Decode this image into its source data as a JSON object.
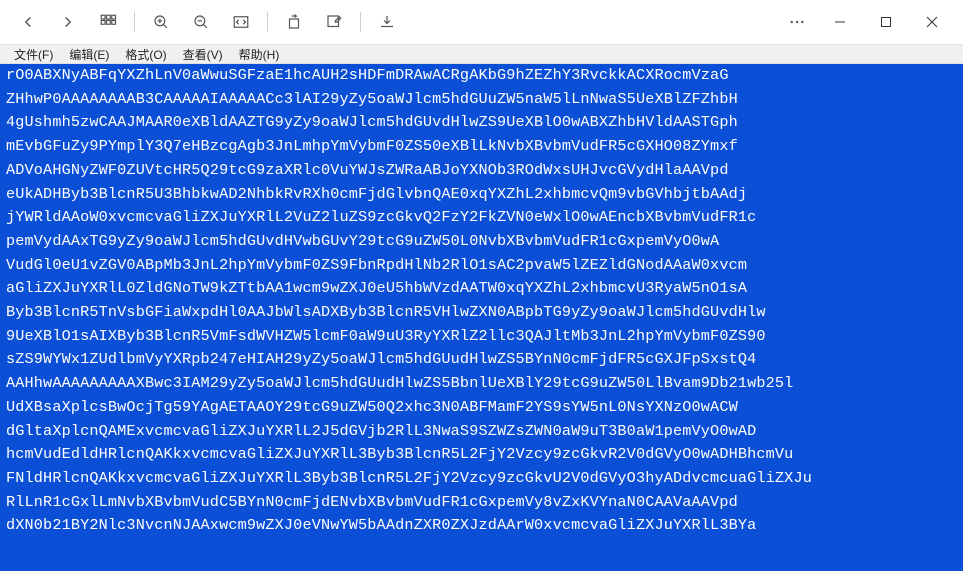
{
  "menu": {
    "file": "文件(F)",
    "edit": "编辑(E)",
    "format": "格式(O)",
    "view": "查看(V)",
    "help": "帮助(H)"
  },
  "icons": {
    "back": "back-icon",
    "forward": "forward-icon",
    "apps": "apps-icon",
    "zoom_in": "zoom-in-icon",
    "zoom_out": "zoom-out-icon",
    "fit": "fit-width-icon",
    "rotate": "rotate-icon",
    "edit": "edit-icon",
    "download": "download-icon",
    "more": "more-icon",
    "minimize": "minimize-icon",
    "maximize": "maximize-icon",
    "close": "close-icon"
  },
  "colors": {
    "selection_bg": "#0a4fd6",
    "selection_fg": "#ffffff",
    "toolbar_icon": "#555555"
  },
  "content_lines": [
    "rO0ABXNyABFqYXZhLnV0aWwuSGFzaE1hcAUH2sHDFmDRAwACRgAKbG9hZEZhY3RvckkACXRocmVzaG",
    "ZHhwP0AAAAAAAAB3CAAAAAIAAAAACc3lAI29yZy5oaWJlcm5hdGUuZW5naW5lLnNwaS5UeXBlZFZhbH",
    "4gUshmh5zwCAAJMAAR0eXBldAAZTG9yZy9oaWJlcm5hdGUvdHlwZS9UeXBlO0wABXZhbHVldAASTGph",
    "mEvbGFuZy9PYmplY3Q7eHBzcgAgb3JnLmhpYmVybmF0ZS50eXBlLkNvbXBvbmVudFR5cGXHO08ZYmxf",
    "ADVoAHGNyZWF0ZUVtcHR5Q29tcG9zaXRlc0VuYWJsZWRaABJoYXNOb3ROdWxsUHJvcGVydHlaAAVpd",
    "eUkADHByb3BlcnR5U3BhbkwAD2NhbkRvRXh0cmFjdGlvbnQAE0xqYXZhL2xhbmcvQm9vbGVhbjtbAAdj",
    "jYWRldAAoW0xvcmcvaGliZXJuYXRlL2VuZ2luZS9zcGkvQ2FzY2FkZVN0eWxlO0wAEncbXBvbmVudFR1c",
    "pemVydAAxTG9yZy9oaWJlcm5hdGUvdHVwbGUvY29tcG9uZW50L0NvbXBvbmVudFR1cGxpemVyO0wA",
    "VudGl0eU1vZGV0ABpMb3JnL2hpYmVybmF0ZS9FbnRpdHlNb2RlO1sAC2pvaW5lZEZldGNodAAaW0xvcm",
    "aGliZXJuYXRlL0ZldGNoTW9kZTtbAA1wcm9wZXJ0eU5hbWVzdAATW0xqYXZhL2xhbmcvU3RyaW5nO1sA",
    "Byb3BlcnR5TnVsbGFiaWxpdHl0AAJbWlsADXByb3BlcnR5VHlwZXN0ABpbTG9yZy9oaWJlcm5hdGUvdHlw",
    "9UeXBlO1sAIXByb3BlcnR5VmFsdWVHZW5lcmF0aW9uU3RyYXRlZ2llc3QAJltMb3JnL2hpYmVybmF0ZS90",
    "sZS9WYWx1ZUdlbmVyYXRpb247eHIAH29yZy5oaWJlcm5hdGUudHlwZS5BYnN0cmFjdFR5cGXJFpSxstQ4",
    "AAHhwAAAAAAAAAXBwc3IAM29yZy5oaWJlcm5hdGUudHlwZS5BbnlUeXBlY29tcG9uZW50LlBvam9Db21wb25l",
    "UdXBsaXplcsBwOcjTg59YAgAETAAOY29tcG9uZW50Q2xhc3N0ABFMamF2YS9sYW5nL0NsYXNzO0wACW",
    "dGltaXplcnQAMExvcmcvaGliZXJuYXRlL2J5dGVjb2RlL3NwaS9SZWZsZWN0aW9uT3B0aW1pemVyO0wAD",
    "hcmVudEdldHRlcnQAKkxvcmcvaGliZXJuYXRlL3Byb3BlcnR5L2FjY2Vzcy9zcGkvR2V0dGVyO0wADHBhcmVu",
    "FNldHRlcnQAKkxvcmcvaGliZXJuYXRlL3Byb3BlcnR5L2FjY2Vzcy9zcGkvU2V0dGVyO3hyADdvcmcuaGliZXJu",
    "RlLnR1cGxlLmNvbXBvbmVudC5BYnN0cmFjdENvbXBvbmVudFR1cGxpemVy8vZxKVYnaN0CAAVaAAVpd",
    "dXN0b21BY2Nlc3NvcnNJAAxwcm9wZXJ0eVNwYW5bAAdnZXR0ZXJzdAArW0xvcmcvaGliZXJuYXRlL3BYa"
  ]
}
